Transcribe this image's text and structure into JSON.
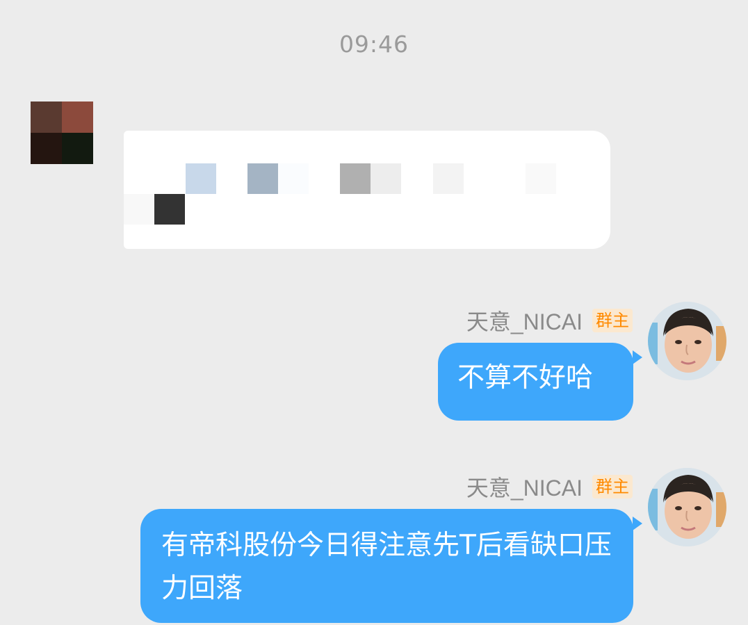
{
  "timestamp": "09:46",
  "messages": [
    {
      "type": "image",
      "sender_avatar_colors": [
        "#5a3a30",
        "#8c4a3c",
        "#241510",
        "#121a10"
      ],
      "image_pixel_colors": [
        "#c8d8ea",
        "#a4b4c4",
        "#fafcfe",
        "#b0b0b0",
        "#ededed",
        "#f3f3f3",
        "#f9f9f9",
        "#333333"
      ]
    },
    {
      "type": "text",
      "sender": "天意_NICAI",
      "role": "群主",
      "text": "不算不好哈"
    },
    {
      "type": "text",
      "sender": "天意_NICAI",
      "role": "群主",
      "text": "有帝科股份今日得注意先T后看缺口压力回落"
    }
  ]
}
